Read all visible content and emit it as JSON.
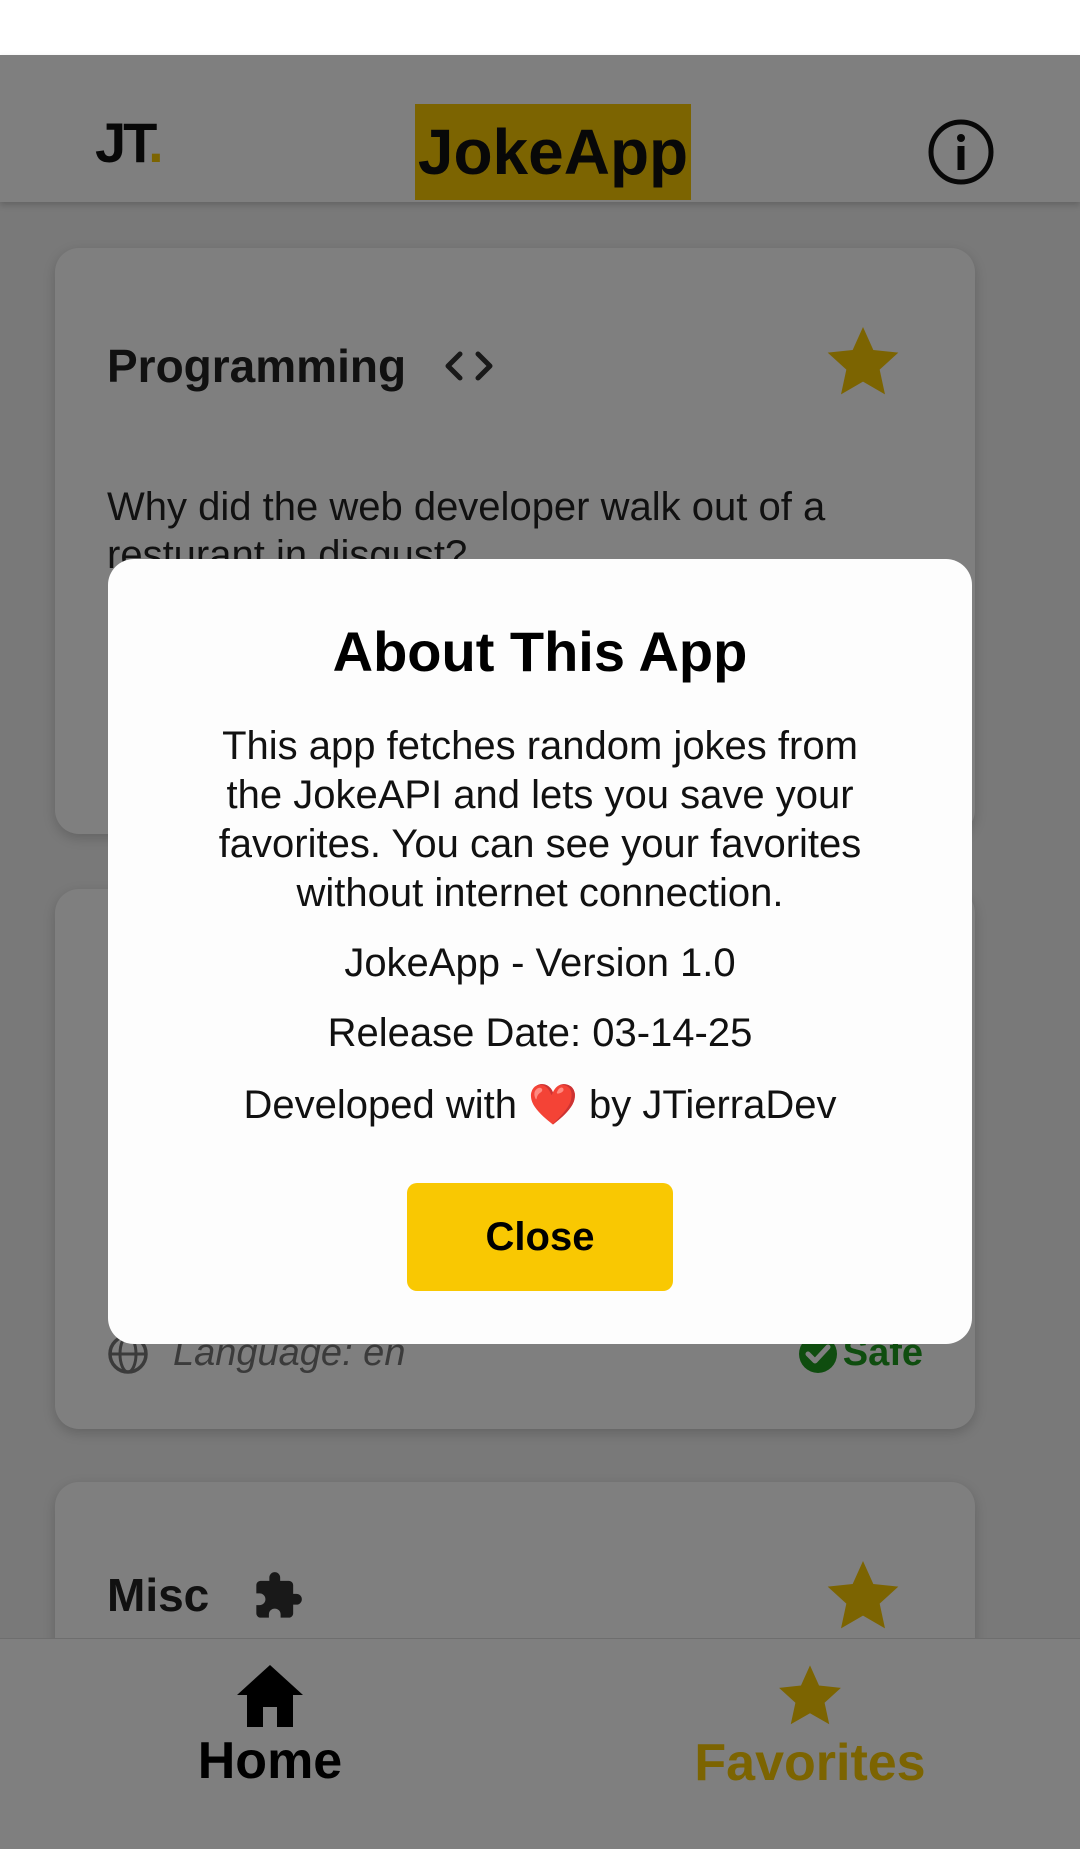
{
  "header": {
    "logo_text": "JT",
    "logo_dot": ".",
    "title": "JokeApp",
    "info_icon": "info-circle-icon"
  },
  "cards": [
    {
      "category": "Programming",
      "category_icon": "code-icon",
      "joke_text": "Why did the web developer walk out of a resturant in disgust?",
      "favorite_icon": "star-icon"
    },
    {
      "language_label": "Language: en",
      "language_icon": "globe-icon",
      "safe_label": "Safe",
      "safe_icon": "check-circle-icon"
    },
    {
      "category": "Misc",
      "category_icon": "puzzle-icon",
      "favorite_icon": "star-icon"
    }
  ],
  "modal": {
    "title": "About This App",
    "description": "This app fetches random jokes from the JokeAPI and lets you save your favorites. You can see your favorites without internet connection.",
    "version": "JokeApp - Version 1.0",
    "release_date": "Release Date: 03-14-25",
    "dev_prefix": "Developed with",
    "dev_heart": "❤️",
    "dev_suffix": "by JTierraDev",
    "close_label": "Close"
  },
  "bottom_nav": {
    "home_label": "Home",
    "favorites_label": "Favorites"
  },
  "colors": {
    "accent": "#f9c802",
    "safe": "#1e9b1e",
    "overlay": "rgba(0,0,0,0.5)"
  }
}
